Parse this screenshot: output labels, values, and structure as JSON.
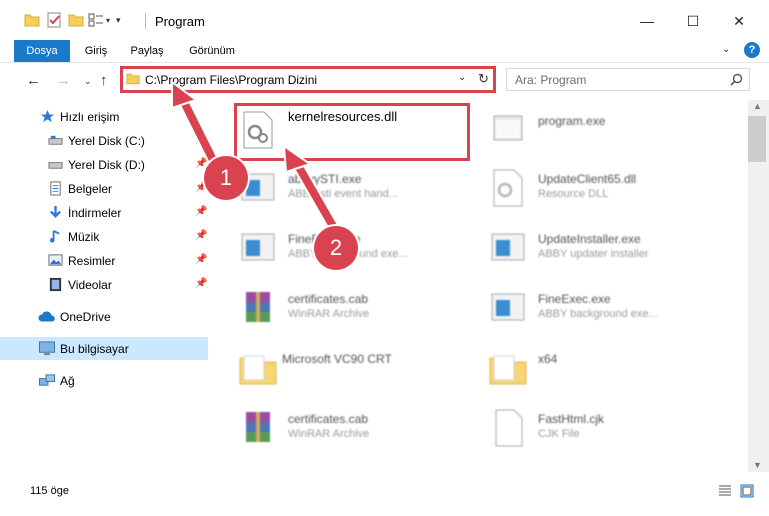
{
  "window": {
    "title": "Program",
    "minimize_label": "—",
    "maximize_label": "☐",
    "close_label": "✕"
  },
  "ribbon": {
    "tabs": [
      {
        "label": "Dosya",
        "active": true
      },
      {
        "label": "Giriş"
      },
      {
        "label": "Paylaş"
      },
      {
        "label": "Görünüm"
      }
    ],
    "help_label": "?"
  },
  "address": {
    "path": "C:\\Program Files\\Program Dizini"
  },
  "search": {
    "placeholder": "Ara: Program"
  },
  "sidebar": {
    "items": [
      {
        "label": "Hızlı erişim",
        "icon": "star-icon"
      },
      {
        "label": "Yerel Disk (C:)",
        "icon": "drive-icon",
        "pinned": true
      },
      {
        "label": "Yerel Disk (D:)",
        "icon": "drive-icon",
        "pinned": true
      },
      {
        "label": "Belgeler",
        "icon": "documents-icon",
        "pinned": true
      },
      {
        "label": "İndirmeler",
        "icon": "download-icon",
        "pinned": true
      },
      {
        "label": "Müzik",
        "icon": "music-icon",
        "pinned": true
      },
      {
        "label": "Resimler",
        "icon": "pictures-icon",
        "pinned": true
      },
      {
        "label": "Videolar",
        "icon": "videos-icon",
        "pinned": true
      },
      {
        "label": "OneDrive",
        "icon": "cloud-icon"
      },
      {
        "label": "Bu bilgisayar",
        "icon": "computer-icon",
        "selected": true
      },
      {
        "label": "Ağ",
        "icon": "network-icon"
      }
    ]
  },
  "files": [
    {
      "name": "kernelresources.dll",
      "desc": "",
      "icon": "dll-icon"
    },
    {
      "name": "program.exe",
      "desc": "",
      "icon": "exe-icon"
    },
    {
      "name": "abbyySTI.exe",
      "desc": "ABBY sti event hand...",
      "icon": "exe-window-icon"
    },
    {
      "name": "UpdateClient65.dll",
      "desc": "Resource DLL",
      "icon": "dll-icon"
    },
    {
      "name": "FineExec.exe",
      "desc": "ABBY background exe...",
      "icon": "exe-window-icon"
    },
    {
      "name": "UpdateInstaller.exe",
      "desc": "ABBY updater installer",
      "icon": "exe-window-icon"
    },
    {
      "name": "certificates.cab",
      "desc": "WinRAR Archive",
      "icon": "winrar-icon"
    },
    {
      "name": "FineExec.exe",
      "desc": "ABBY background exe...",
      "icon": "exe-window-icon"
    },
    {
      "name": "Microsoft VC90 CRT",
      "desc": "",
      "icon": "folder-icon"
    },
    {
      "name": "x64",
      "desc": "",
      "icon": "folder-icon"
    },
    {
      "name": "certificates.cab",
      "desc": "WinRAR Archive",
      "icon": "winrar-icon"
    },
    {
      "name": "FastHtml.cjk",
      "desc": "CJK File",
      "icon": "file-icon"
    }
  ],
  "status": {
    "count": "115 öge"
  },
  "markers": [
    "1",
    "2"
  ],
  "colors": {
    "accent": "#1979ca",
    "highlight": "#d9424f",
    "selected": "#cce8ff"
  }
}
